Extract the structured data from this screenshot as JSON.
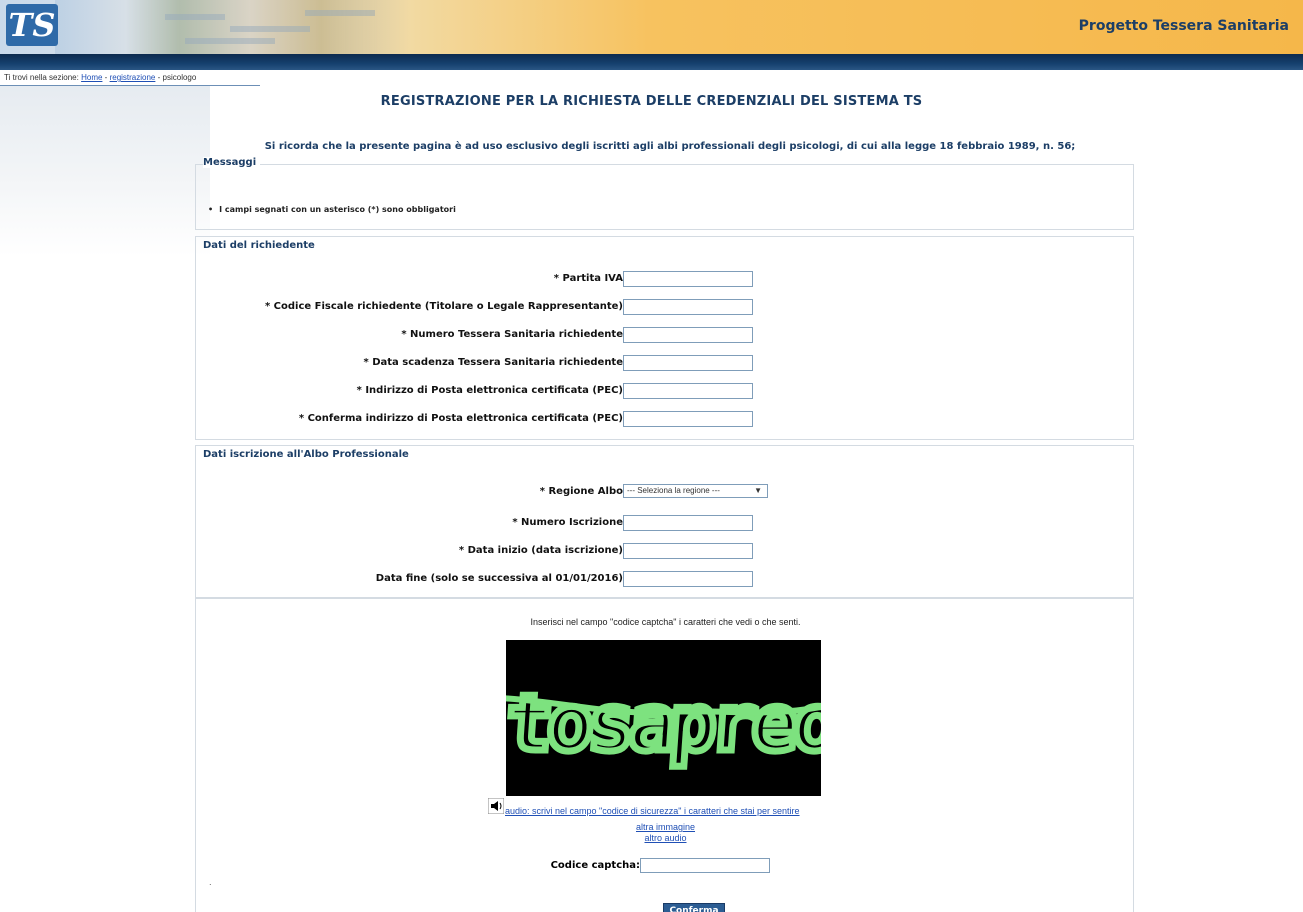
{
  "header": {
    "logo_text": "TS",
    "site_title": "Progetto Tessera Sanitaria"
  },
  "breadcrumb": {
    "prefix": "Ti trovi nella sezione:",
    "home": "Home",
    "sep1": "-",
    "registrazione": "registrazione",
    "sep2": "-",
    "current": "psicologo"
  },
  "page": {
    "title": "REGISTRAZIONE PER LA RICHIESTA DELLE CREDENZIALI DEL SISTEMA TS",
    "notice": "Si ricorda che la presente pagina è ad uso esclusivo degli iscritti agli albi professionali degli psicologi, di cui alla legge 18 febbraio 1989, n. 56;"
  },
  "messages": {
    "title": "Messaggi",
    "items": [
      "I campi segnati con un asterisco (*) sono obbligatori"
    ]
  },
  "richiedente": {
    "title": "Dati del richiedente",
    "fields": [
      {
        "label": "* Partita IVA",
        "value": ""
      },
      {
        "label": "* Codice Fiscale richiedente (Titolare o Legale Rappresentante)",
        "value": ""
      },
      {
        "label": "* Numero Tessera Sanitaria richiedente",
        "value": ""
      },
      {
        "label": "* Data scadenza Tessera Sanitaria richiedente",
        "value": ""
      },
      {
        "label": "* Indirizzo di Posta elettronica certificata (PEC)",
        "value": ""
      },
      {
        "label": "* Conferma indirizzo di Posta elettronica certificata (PEC)",
        "value": ""
      }
    ]
  },
  "albo": {
    "title": "Dati iscrizione all'Albo Professionale",
    "regione_label": "* Regione Albo",
    "regione_selected": "--- Seleziona la regione ---",
    "fields": [
      {
        "label": "* Numero Iscrizione",
        "value": ""
      },
      {
        "label": "* Data inizio (data iscrizione)",
        "value": ""
      },
      {
        "label": "Data fine (solo se successiva al 01/01/2016)",
        "value": ""
      }
    ]
  },
  "captcha": {
    "instruction": "Inserisci nel campo \"codice captcha\" i caratteri che vedi o che senti.",
    "image_text": "tosapreo",
    "audio_link": "audio: scrivi nel campo \"codice di sicurezza\" i caratteri che stai per sentire",
    "altra_immagine": "altra immagine",
    "altro_audio": "altro audio",
    "code_label": "Codice captcha:",
    "code_value": "",
    "dot": "."
  },
  "actions": {
    "submit_label": "Conferma"
  },
  "colors": {
    "accent_dark_blue": "#1c3e66",
    "header_orange": "#f7c25f",
    "link_blue": "#1f4fb5",
    "captcha_text_green": "#7de27f"
  }
}
